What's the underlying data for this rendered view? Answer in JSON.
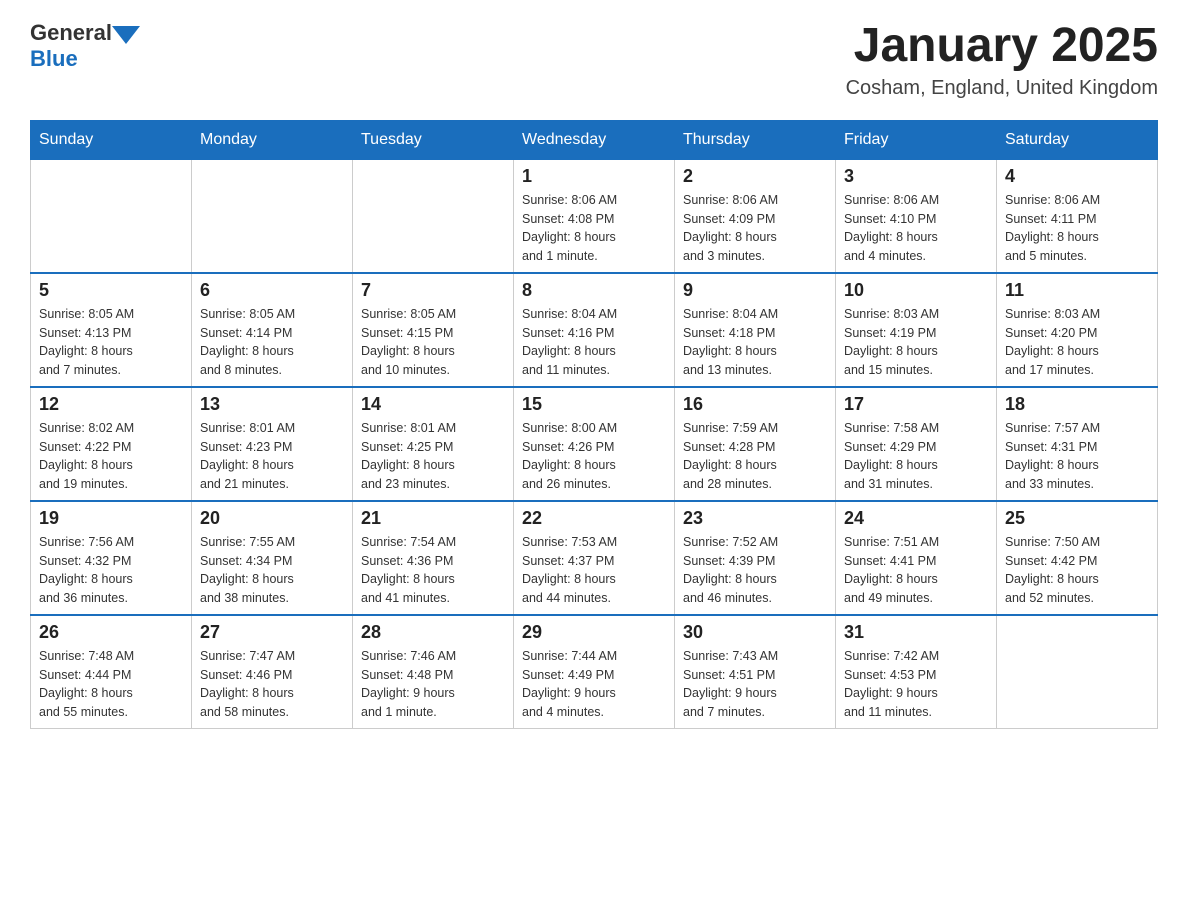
{
  "header": {
    "logo_general": "General",
    "logo_blue": "Blue",
    "title": "January 2025",
    "subtitle": "Cosham, England, United Kingdom"
  },
  "calendar": {
    "days": [
      "Sunday",
      "Monday",
      "Tuesday",
      "Wednesday",
      "Thursday",
      "Friday",
      "Saturday"
    ],
    "weeks": [
      [
        {
          "day": "",
          "info": ""
        },
        {
          "day": "",
          "info": ""
        },
        {
          "day": "",
          "info": ""
        },
        {
          "day": "1",
          "info": "Sunrise: 8:06 AM\nSunset: 4:08 PM\nDaylight: 8 hours\nand 1 minute."
        },
        {
          "day": "2",
          "info": "Sunrise: 8:06 AM\nSunset: 4:09 PM\nDaylight: 8 hours\nand 3 minutes."
        },
        {
          "day": "3",
          "info": "Sunrise: 8:06 AM\nSunset: 4:10 PM\nDaylight: 8 hours\nand 4 minutes."
        },
        {
          "day": "4",
          "info": "Sunrise: 8:06 AM\nSunset: 4:11 PM\nDaylight: 8 hours\nand 5 minutes."
        }
      ],
      [
        {
          "day": "5",
          "info": "Sunrise: 8:05 AM\nSunset: 4:13 PM\nDaylight: 8 hours\nand 7 minutes."
        },
        {
          "day": "6",
          "info": "Sunrise: 8:05 AM\nSunset: 4:14 PM\nDaylight: 8 hours\nand 8 minutes."
        },
        {
          "day": "7",
          "info": "Sunrise: 8:05 AM\nSunset: 4:15 PM\nDaylight: 8 hours\nand 10 minutes."
        },
        {
          "day": "8",
          "info": "Sunrise: 8:04 AM\nSunset: 4:16 PM\nDaylight: 8 hours\nand 11 minutes."
        },
        {
          "day": "9",
          "info": "Sunrise: 8:04 AM\nSunset: 4:18 PM\nDaylight: 8 hours\nand 13 minutes."
        },
        {
          "day": "10",
          "info": "Sunrise: 8:03 AM\nSunset: 4:19 PM\nDaylight: 8 hours\nand 15 minutes."
        },
        {
          "day": "11",
          "info": "Sunrise: 8:03 AM\nSunset: 4:20 PM\nDaylight: 8 hours\nand 17 minutes."
        }
      ],
      [
        {
          "day": "12",
          "info": "Sunrise: 8:02 AM\nSunset: 4:22 PM\nDaylight: 8 hours\nand 19 minutes."
        },
        {
          "day": "13",
          "info": "Sunrise: 8:01 AM\nSunset: 4:23 PM\nDaylight: 8 hours\nand 21 minutes."
        },
        {
          "day": "14",
          "info": "Sunrise: 8:01 AM\nSunset: 4:25 PM\nDaylight: 8 hours\nand 23 minutes."
        },
        {
          "day": "15",
          "info": "Sunrise: 8:00 AM\nSunset: 4:26 PM\nDaylight: 8 hours\nand 26 minutes."
        },
        {
          "day": "16",
          "info": "Sunrise: 7:59 AM\nSunset: 4:28 PM\nDaylight: 8 hours\nand 28 minutes."
        },
        {
          "day": "17",
          "info": "Sunrise: 7:58 AM\nSunset: 4:29 PM\nDaylight: 8 hours\nand 31 minutes."
        },
        {
          "day": "18",
          "info": "Sunrise: 7:57 AM\nSunset: 4:31 PM\nDaylight: 8 hours\nand 33 minutes."
        }
      ],
      [
        {
          "day": "19",
          "info": "Sunrise: 7:56 AM\nSunset: 4:32 PM\nDaylight: 8 hours\nand 36 minutes."
        },
        {
          "day": "20",
          "info": "Sunrise: 7:55 AM\nSunset: 4:34 PM\nDaylight: 8 hours\nand 38 minutes."
        },
        {
          "day": "21",
          "info": "Sunrise: 7:54 AM\nSunset: 4:36 PM\nDaylight: 8 hours\nand 41 minutes."
        },
        {
          "day": "22",
          "info": "Sunrise: 7:53 AM\nSunset: 4:37 PM\nDaylight: 8 hours\nand 44 minutes."
        },
        {
          "day": "23",
          "info": "Sunrise: 7:52 AM\nSunset: 4:39 PM\nDaylight: 8 hours\nand 46 minutes."
        },
        {
          "day": "24",
          "info": "Sunrise: 7:51 AM\nSunset: 4:41 PM\nDaylight: 8 hours\nand 49 minutes."
        },
        {
          "day": "25",
          "info": "Sunrise: 7:50 AM\nSunset: 4:42 PM\nDaylight: 8 hours\nand 52 minutes."
        }
      ],
      [
        {
          "day": "26",
          "info": "Sunrise: 7:48 AM\nSunset: 4:44 PM\nDaylight: 8 hours\nand 55 minutes."
        },
        {
          "day": "27",
          "info": "Sunrise: 7:47 AM\nSunset: 4:46 PM\nDaylight: 8 hours\nand 58 minutes."
        },
        {
          "day": "28",
          "info": "Sunrise: 7:46 AM\nSunset: 4:48 PM\nDaylight: 9 hours\nand 1 minute."
        },
        {
          "day": "29",
          "info": "Sunrise: 7:44 AM\nSunset: 4:49 PM\nDaylight: 9 hours\nand 4 minutes."
        },
        {
          "day": "30",
          "info": "Sunrise: 7:43 AM\nSunset: 4:51 PM\nDaylight: 9 hours\nand 7 minutes."
        },
        {
          "day": "31",
          "info": "Sunrise: 7:42 AM\nSunset: 4:53 PM\nDaylight: 9 hours\nand 11 minutes."
        },
        {
          "day": "",
          "info": ""
        }
      ]
    ]
  }
}
